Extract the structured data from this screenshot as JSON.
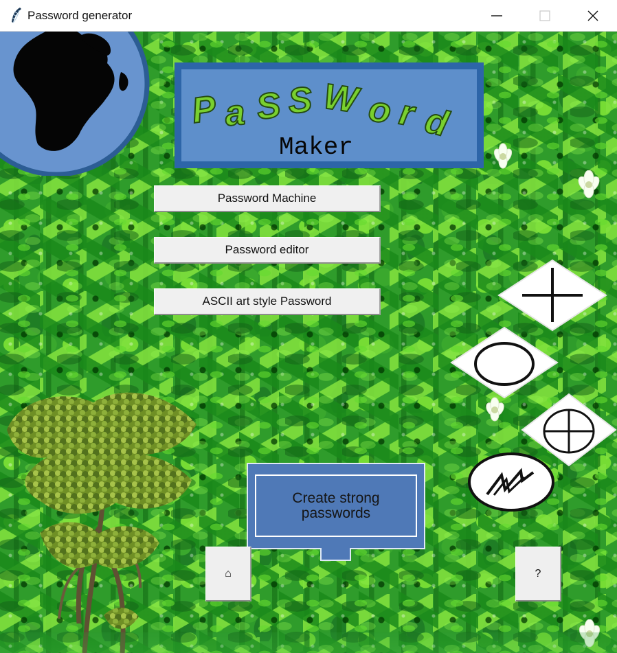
{
  "window": {
    "title": "Password generator",
    "icon": "feather-icon"
  },
  "window_controls": {
    "minimize_icon": "minimize-icon",
    "maximize_icon": "maximize-icon",
    "close_icon": "close-icon"
  },
  "logo": {
    "top_word": "PaSSWord",
    "bottom_word": "Maker"
  },
  "menu": {
    "items": [
      {
        "label": "Password Machine"
      },
      {
        "label": "Password editor"
      },
      {
        "label": "ASCII art style Password"
      }
    ]
  },
  "cta": {
    "label": "Create strong\npasswords"
  },
  "buttons": {
    "home_label": "⌂",
    "help_label": "?"
  },
  "decorations": {
    "icons": [
      "globe-icon",
      "plus-diamond-icon",
      "circle-diamond-icon",
      "circle-plus-diamond-icon",
      "lightning-circle-icon",
      "tree-icon",
      "flower-icon"
    ],
    "colors": {
      "background_green": "#2f9c2b",
      "logo_blue": "#5e8fcb",
      "logo_border": "#2d65a8",
      "logo_text_green": "#79d02f",
      "button_gray": "#f0f0f0"
    }
  }
}
